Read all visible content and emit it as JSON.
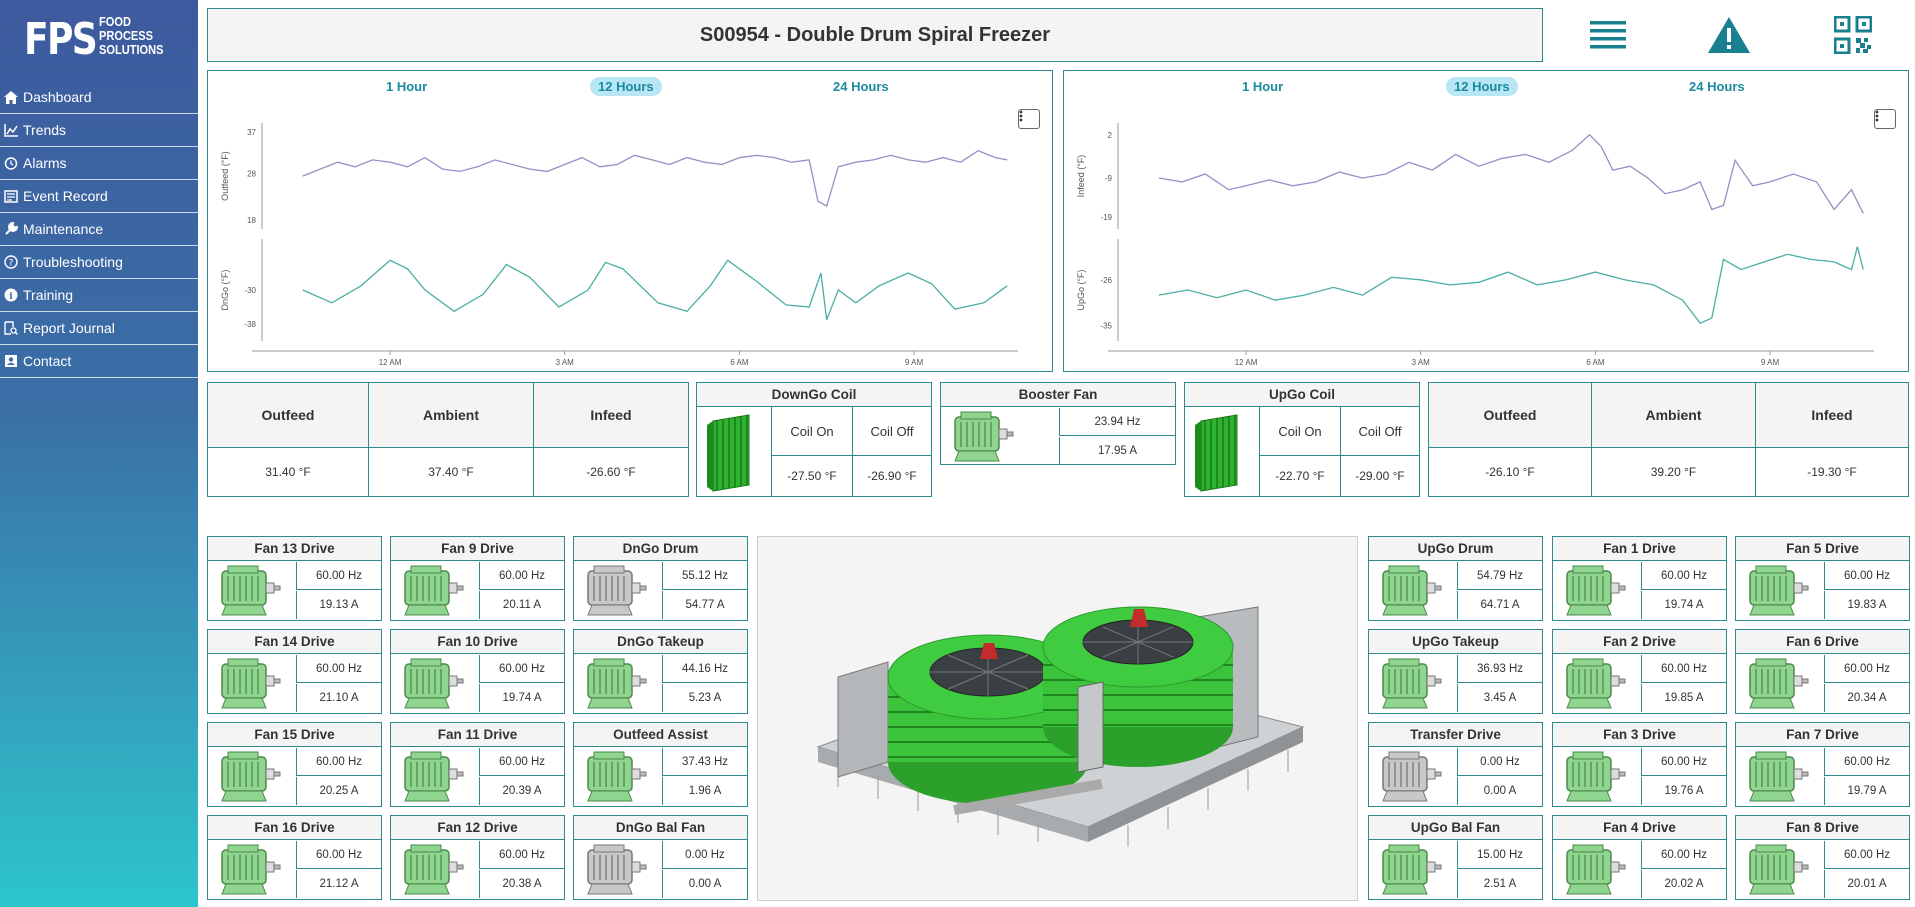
{
  "brand": {
    "mark": "FPS",
    "line1": "FOOD",
    "line2": "PROCESS",
    "line3": "SOLUTIONS"
  },
  "nav": [
    {
      "label": "Dashboard",
      "icon": "home-icon"
    },
    {
      "label": "Trends",
      "icon": "trends-icon"
    },
    {
      "label": "Alarms",
      "icon": "alarm-clock-icon"
    },
    {
      "label": "Event Record",
      "icon": "event-record-icon"
    },
    {
      "label": "Maintenance",
      "icon": "wrench-icon"
    },
    {
      "label": "Troubleshooting",
      "icon": "question-circle-icon"
    },
    {
      "label": "Training",
      "icon": "info-circle-icon"
    },
    {
      "label": "Report Journal",
      "icon": "report-search-icon"
    },
    {
      "label": "Contact",
      "icon": "contact-card-icon"
    }
  ],
  "header": {
    "title": "S00954 - Double Drum Spiral Freezer"
  },
  "colors": {
    "teal": "#2e8a8f",
    "accent": "#1c8aa0",
    "tab_active": "#b8e6f4",
    "motor_green": "#8fd48f",
    "motor_gray": "#c8c8c8",
    "upper_series": "#9490c4",
    "lower_series": "#4aaea4"
  },
  "left_chart": {
    "tabs": [
      "1 Hour",
      "12 Hours",
      "24 Hours"
    ],
    "active_tab": "12 Hours",
    "chart_data": {
      "type": "line",
      "x_ticks": [
        "12 AM",
        "3 AM",
        "6 AM",
        "9 AM"
      ],
      "panels": [
        {
          "ylabel": "Outfeed (°F)",
          "yticks": [
            "37",
            "28",
            "18"
          ],
          "ylim": [
            16,
            39
          ],
          "series": {
            "x_hours": [
              -1.5,
              -1.2,
              -0.9,
              -0.6,
              -0.3,
              0,
              0.3,
              0.6,
              0.9,
              1.2,
              1.5,
              1.8,
              2.1,
              2.4,
              2.7,
              3,
              3.3,
              3.6,
              3.9,
              4.2,
              4.5,
              4.8,
              5.1,
              5.4,
              5.7,
              6,
              6.3,
              6.6,
              6.9,
              7.2,
              7.35,
              7.5,
              7.7,
              8,
              8.3,
              8.6,
              8.9,
              9.2,
              9.5,
              9.8,
              10.1,
              10.4,
              10.6
            ],
            "values": [
              27.5,
              29,
              30.5,
              29.5,
              31,
              30.5,
              29.5,
              31.5,
              29,
              28.5,
              29.5,
              31,
              30,
              29,
              28.5,
              30,
              31.5,
              29.5,
              30,
              32,
              31,
              30,
              31.5,
              30.5,
              30,
              31.5,
              32,
              31.5,
              30.5,
              31,
              22,
              21,
              29.5,
              30.5,
              31,
              32,
              31,
              30.5,
              31.5,
              30.5,
              33,
              31.5,
              31
            ]
          }
        },
        {
          "ylabel": "DnGo (°F)",
          "yticks": [
            "-30",
            "-38"
          ],
          "ylim": [
            -42,
            -18
          ],
          "series": {
            "x_hours": [
              -1.5,
              -1.0,
              -0.5,
              0,
              0.3,
              0.6,
              1.1,
              1.6,
              2.0,
              2.4,
              2.9,
              3.4,
              3.7,
              4.0,
              4.6,
              5.1,
              5.5,
              5.8,
              6.3,
              6.8,
              7.2,
              7.4,
              7.5,
              7.7,
              8.0,
              8.4,
              8.9,
              9.3,
              9.7,
              10.2,
              10.6
            ],
            "values": [
              -30,
              -33,
              -29,
              -23,
              -25,
              -30,
              -35,
              -31,
              -24,
              -27,
              -34,
              -30,
              -23.5,
              -25,
              -33,
              -35,
              -29,
              -23,
              -28,
              -33.5,
              -34,
              -26,
              -37,
              -30,
              -33,
              -29,
              -26,
              -28.5,
              -34.5,
              -33,
              -29
            ]
          }
        }
      ]
    }
  },
  "right_chart": {
    "tabs": [
      "1 Hour",
      "12 Hours",
      "24 Hours"
    ],
    "active_tab": "12 Hours",
    "chart_data": {
      "type": "line",
      "x_ticks": [
        "12 AM",
        "3 AM",
        "6 AM",
        "9 AM"
      ],
      "panels": [
        {
          "ylabel": "Infeed (°F)",
          "yticks": [
            "2",
            "-9",
            "-19"
          ],
          "ylim": [
            -22,
            5
          ],
          "series": {
            "x_hours": [
              -1.5,
              -1.1,
              -0.7,
              -0.3,
              0,
              0.4,
              0.8,
              1.2,
              1.6,
              2.0,
              2.4,
              2.8,
              3.2,
              3.6,
              4.0,
              4.4,
              4.8,
              5.2,
              5.6,
              5.9,
              6.1,
              6.3,
              6.6,
              6.9,
              7.2,
              7.5,
              7.8,
              8.0,
              8.2,
              8.4,
              8.7,
              9.0,
              9.4,
              9.8,
              10.1,
              10.4,
              10.6
            ],
            "values": [
              -9,
              -10,
              -8,
              -12,
              -11,
              -9.5,
              -11,
              -10,
              -7.5,
              -9,
              -8,
              -5,
              -7,
              -3,
              -6,
              -4,
              -3,
              -5,
              -2,
              2,
              -1,
              -7,
              -6,
              -9,
              -13,
              -12,
              -10,
              -17,
              -16,
              -4.5,
              -11,
              -10,
              -8,
              -10,
              -17,
              -12,
              -18
            ]
          }
        },
        {
          "ylabel": "UpGo (°F)",
          "yticks": [
            "-26",
            "-35"
          ],
          "ylim": [
            -38,
            -18
          ],
          "series": {
            "x_hours": [
              -1.5,
              -1.0,
              -0.5,
              0,
              0.5,
              1.0,
              1.5,
              2.0,
              2.5,
              3.0,
              3.5,
              4.0,
              4.5,
              5.0,
              5.5,
              6.0,
              6.5,
              7.0,
              7.5,
              7.8,
              8.0,
              8.2,
              8.5,
              8.9,
              9.3,
              9.7,
              10.1,
              10.4,
              10.5,
              10.6
            ],
            "values": [
              -29,
              -28,
              -29.5,
              -28,
              -30,
              -29,
              -27.5,
              -29,
              -25.5,
              -26,
              -27,
              -26.5,
              -24.5,
              -27,
              -26,
              -24.5,
              -26,
              -27,
              -30,
              -34.5,
              -33.5,
              -22,
              -24,
              -22.5,
              -21,
              -22,
              -22.5,
              -24,
              -19.5,
              -24
            ]
          }
        }
      ]
    }
  },
  "left_temps": {
    "headers": [
      "Outfeed",
      "Ambient",
      "Infeed"
    ],
    "values": [
      "31.40 °F",
      "37.40 °F",
      "-26.60 °F"
    ]
  },
  "right_temps": {
    "headers": [
      "Outfeed",
      "Ambient",
      "Infeed"
    ],
    "values": [
      "-26.10 °F",
      "39.20 °F",
      "-19.30 °F"
    ]
  },
  "downgo_coil": {
    "title": "DownGo Coil",
    "on_label": "Coil On",
    "off_label": "Coil Off",
    "on_value": "-27.50 °F",
    "off_value": "-26.90 °F"
  },
  "upgo_coil": {
    "title": "UpGo Coil",
    "on_label": "Coil On",
    "off_label": "Coil Off",
    "on_value": "-22.70 °F",
    "off_value": "-29.00 °F"
  },
  "booster_fan": {
    "title": "Booster Fan",
    "hz": "23.94 Hz",
    "amps": "17.95 A"
  },
  "drives": [
    {
      "title": "Fan 13 Drive",
      "hz": "60.00 Hz",
      "a": "19.13 A",
      "status": "green"
    },
    {
      "title": "Fan 9 Drive",
      "hz": "60.00 Hz",
      "a": "20.11 A",
      "status": "green"
    },
    {
      "title": "DnGo Drum",
      "hz": "55.12 Hz",
      "a": "54.77 A",
      "status": "gray"
    },
    {
      "title": "UpGo Drum",
      "hz": "54.79 Hz",
      "a": "64.71 A",
      "status": "green"
    },
    {
      "title": "Fan 1 Drive",
      "hz": "60.00 Hz",
      "a": "19.74 A",
      "status": "green"
    },
    {
      "title": "Fan 5 Drive",
      "hz": "60.00 Hz",
      "a": "19.83 A",
      "status": "green"
    },
    {
      "title": "Fan 14 Drive",
      "hz": "60.00 Hz",
      "a": "21.10 A",
      "status": "green"
    },
    {
      "title": "Fan 10 Drive",
      "hz": "60.00 Hz",
      "a": "19.74 A",
      "status": "green"
    },
    {
      "title": "DnGo Takeup",
      "hz": "44.16 Hz",
      "a": "5.23 A",
      "status": "green"
    },
    {
      "title": "UpGo Takeup",
      "hz": "36.93 Hz",
      "a": "3.45 A",
      "status": "green"
    },
    {
      "title": "Fan 2 Drive",
      "hz": "60.00 Hz",
      "a": "19.85 A",
      "status": "green"
    },
    {
      "title": "Fan 6 Drive",
      "hz": "60.00 Hz",
      "a": "20.34 A",
      "status": "green"
    },
    {
      "title": "Fan 15 Drive",
      "hz": "60.00 Hz",
      "a": "20.25 A",
      "status": "green"
    },
    {
      "title": "Fan 11 Drive",
      "hz": "60.00 Hz",
      "a": "20.39 A",
      "status": "green"
    },
    {
      "title": "Outfeed Assist",
      "hz": "37.43 Hz",
      "a": "1.96 A",
      "status": "green"
    },
    {
      "title": "Transfer Drive",
      "hz": "0.00 Hz",
      "a": "0.00 A",
      "status": "gray"
    },
    {
      "title": "Fan 3 Drive",
      "hz": "60.00 Hz",
      "a": "19.76 A",
      "status": "green"
    },
    {
      "title": "Fan 7 Drive",
      "hz": "60.00 Hz",
      "a": "19.79 A",
      "status": "green"
    },
    {
      "title": "Fan 16 Drive",
      "hz": "60.00 Hz",
      "a": "21.12 A",
      "status": "green"
    },
    {
      "title": "Fan 12 Drive",
      "hz": "60.00 Hz",
      "a": "20.38 A",
      "status": "green"
    },
    {
      "title": "DnGo Bal Fan",
      "hz": "0.00 Hz",
      "a": "0.00 A",
      "status": "gray"
    },
    {
      "title": "UpGo Bal Fan",
      "hz": "15.00 Hz",
      "a": "2.51 A",
      "status": "green"
    },
    {
      "title": "Fan 4 Drive",
      "hz": "60.00 Hz",
      "a": "20.02 A",
      "status": "green"
    },
    {
      "title": "Fan 8 Drive",
      "hz": "60.00 Hz",
      "a": "20.01 A",
      "status": "green"
    }
  ]
}
